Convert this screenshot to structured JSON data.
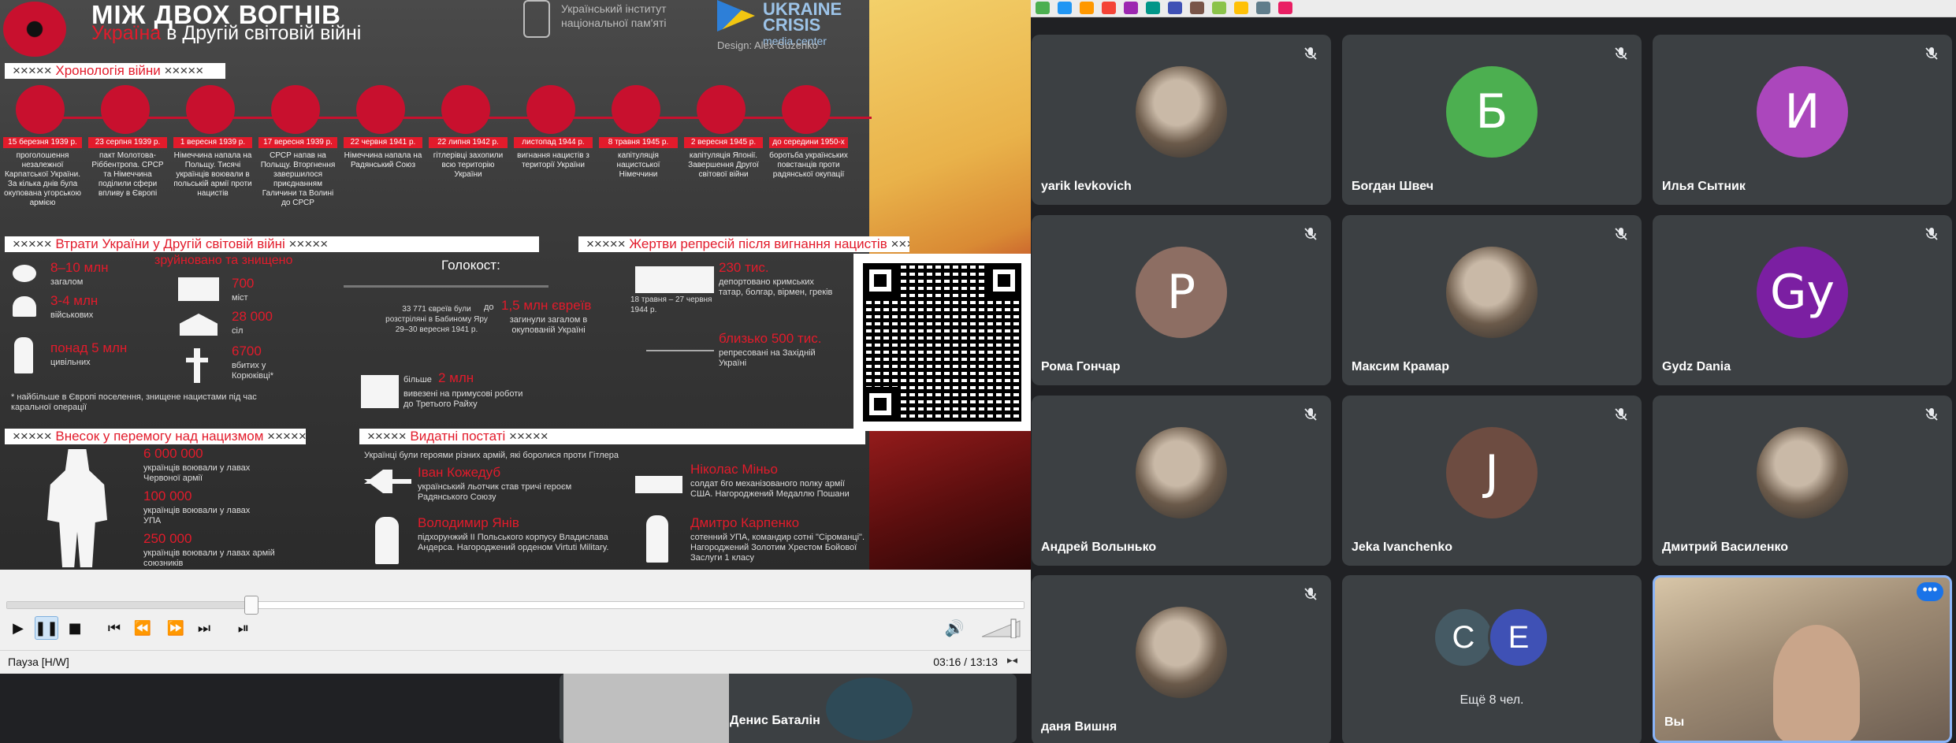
{
  "poster": {
    "title": "МІЖ ДВОХ ВОГНІВ",
    "subtitle_red": "Україна",
    "subtitle_rest": " в Другій світовій війні",
    "institute": "Український інститут національної пам'яті",
    "crisis_title": "UKRAINE CRISIS",
    "crisis_sub": "media center",
    "design": "Design: Alex Guzenko",
    "section_chronology": "Хронологія війни",
    "section_losses": "Втрати України у Другій світовій війні",
    "section_repressions": "Жертви репресій після вигнання нацистів",
    "section_contribution": "Внесок у перемогу над нацизмом",
    "section_figures": "Видатні постаті",
    "stars": "×××××",
    "timeline": [
      {
        "date": "15 березня 1939 р.",
        "text": "проголошення незалежної Карпатської України. За кілька днів була окупована угорською армією"
      },
      {
        "date": "23 серпня 1939 р.",
        "text": "пакт Молотова-Ріббентропа. СРСР та Німеччина поділили сфери впливу в Європі"
      },
      {
        "date": "1 вересня 1939 р.",
        "text": "Німеччина напала на Польщу. Тисячі українців воювали в польській армії проти нацистів"
      },
      {
        "date": "17 вересня 1939 р.",
        "text": "СРСР напав на Польщу. Вторгнення завершилося приєднанням Галичини та Волині до СРСР"
      },
      {
        "date": "22 червня 1941 р.",
        "text": "Німеччина напала на Радянський Союз"
      },
      {
        "date": "22 липня 1942 р.",
        "text": "гітлерівці захопили всю територію України"
      },
      {
        "date": "листопад 1944 р.",
        "text": "вигнання нацистів з території України"
      },
      {
        "date": "8 травня 1945 р.",
        "text": "капітуляція нацистської Німеччини"
      },
      {
        "date": "2 вересня 1945 р.",
        "text": "капітуляція Японії. Завершення Другої світової війни"
      },
      {
        "date": "до середини 1950-х",
        "text": "боротьба українських повстанців проти радянської окупації"
      }
    ],
    "losses": {
      "total_value": "8–10 млн",
      "total_label": "загалом",
      "military_value": "3-4 млн",
      "military_label": "військових",
      "civil_value": "понад 5 млн",
      "civil_label": "цивільних",
      "destroyed": "зруйновано та знищено",
      "cities_value": "700",
      "cities_label": "міст",
      "villages_value": "28 000",
      "villages_label": "сіл",
      "killed_value": "6700",
      "killed_label": "вбитих у Корюківці*",
      "holocaust": "Голокост:",
      "babyn_text": "33 771 євреїв були розстріляні в Бабиному Яру 29–30 вересня 1941 р.",
      "holo_value": "1,5 млн євреїв",
      "holo_prefix": "до",
      "holo_label": "загинули загалом в окупованій Україні",
      "forced_value": "2 млн",
      "forced_prefix": "більше",
      "forced_label": "вивезені на примусові роботи до Третього Райху",
      "footnote": "* найбільше в Європі поселення, знищене нацистами під час каральної операції"
    },
    "repressions": {
      "deported_value": "230 тис.",
      "deported_label": "депортовано кримських татар, болгар, вірмен, греків",
      "deported_date": "18 травня – 27 червня 1944 р.",
      "repressed_value": "близько 500 тис.",
      "repressed_label": "репресовані на Західній Україні"
    },
    "contribution": {
      "red_army_value": "6 000 000",
      "red_army_label": "українців воювали у лавах Червоної армії",
      "upa_value": "100 000",
      "upa_label": "українців воювали у лавах УПА",
      "allies_value": "250 000",
      "allies_label": "українців воювали у лавах армій союзників"
    },
    "figures": {
      "intro": "Українці були героями різних армій, які боролися проти Гітлера",
      "f1_name": "Іван Кожедуб",
      "f1_text": "український льотчик став тричі героєм Радянського Союзу",
      "f2_name": "Володимир Янів",
      "f2_text": "підхорунжий II Польського корпусу Владислава Андерса. Нагороджений орденом Virtuti Military.",
      "f3_name": "Ніколас Міньо",
      "f3_text": "солдат 6го механізованого полку армії США. Нагороджений Медаллю Пошани",
      "f4_name": "Дмитро Карпенко",
      "f4_text": "сотенний УПА, командир сотні \"Сіроманці\". Нагороджений Золотим Хрестом Бойової Заслуги 1 класу"
    }
  },
  "player": {
    "progress_fraction": 0.24,
    "status_left": "Пауза [H/W]",
    "time": "03:16 / 13:13",
    "volume_fraction": 0.9
  },
  "meet": {
    "tiles": [
      {
        "name": "yarik levkovich",
        "initial": "",
        "color": "#5f6368"
      },
      {
        "name": "Богдан Швеч",
        "initial": "Б",
        "color": "#4caf50"
      },
      {
        "name": "Илья Сытник",
        "initial": "И",
        "color": "#ab47bc"
      },
      {
        "name": "Рома Гончар",
        "initial": "Р",
        "color": "#8d6e63"
      },
      {
        "name": "Максим Крамар",
        "initial": "",
        "color": "#5f6368"
      },
      {
        "name": "Gydz Dania",
        "initial": "Gy",
        "color": "#7b1fa2"
      },
      {
        "name": "Андрей Волынько",
        "initial": "",
        "color": "#5f6368"
      },
      {
        "name": "Jeka Ivanchenko",
        "initial": "J",
        "color": "#6d4c41"
      },
      {
        "name": "Дмитрий Василенко",
        "initial": "",
        "color": "#5f6368"
      },
      {
        "name": "даня Вишня",
        "initial": "",
        "color": "#5f6368"
      }
    ],
    "more_initial_1": "С",
    "more_initial_2": "Е",
    "more_color_1": "#455a64",
    "more_color_2": "#3f51b5",
    "more_label": "Ещё 8 чел.",
    "self_name": "Вы",
    "behind_name": "Денис Баталін"
  }
}
